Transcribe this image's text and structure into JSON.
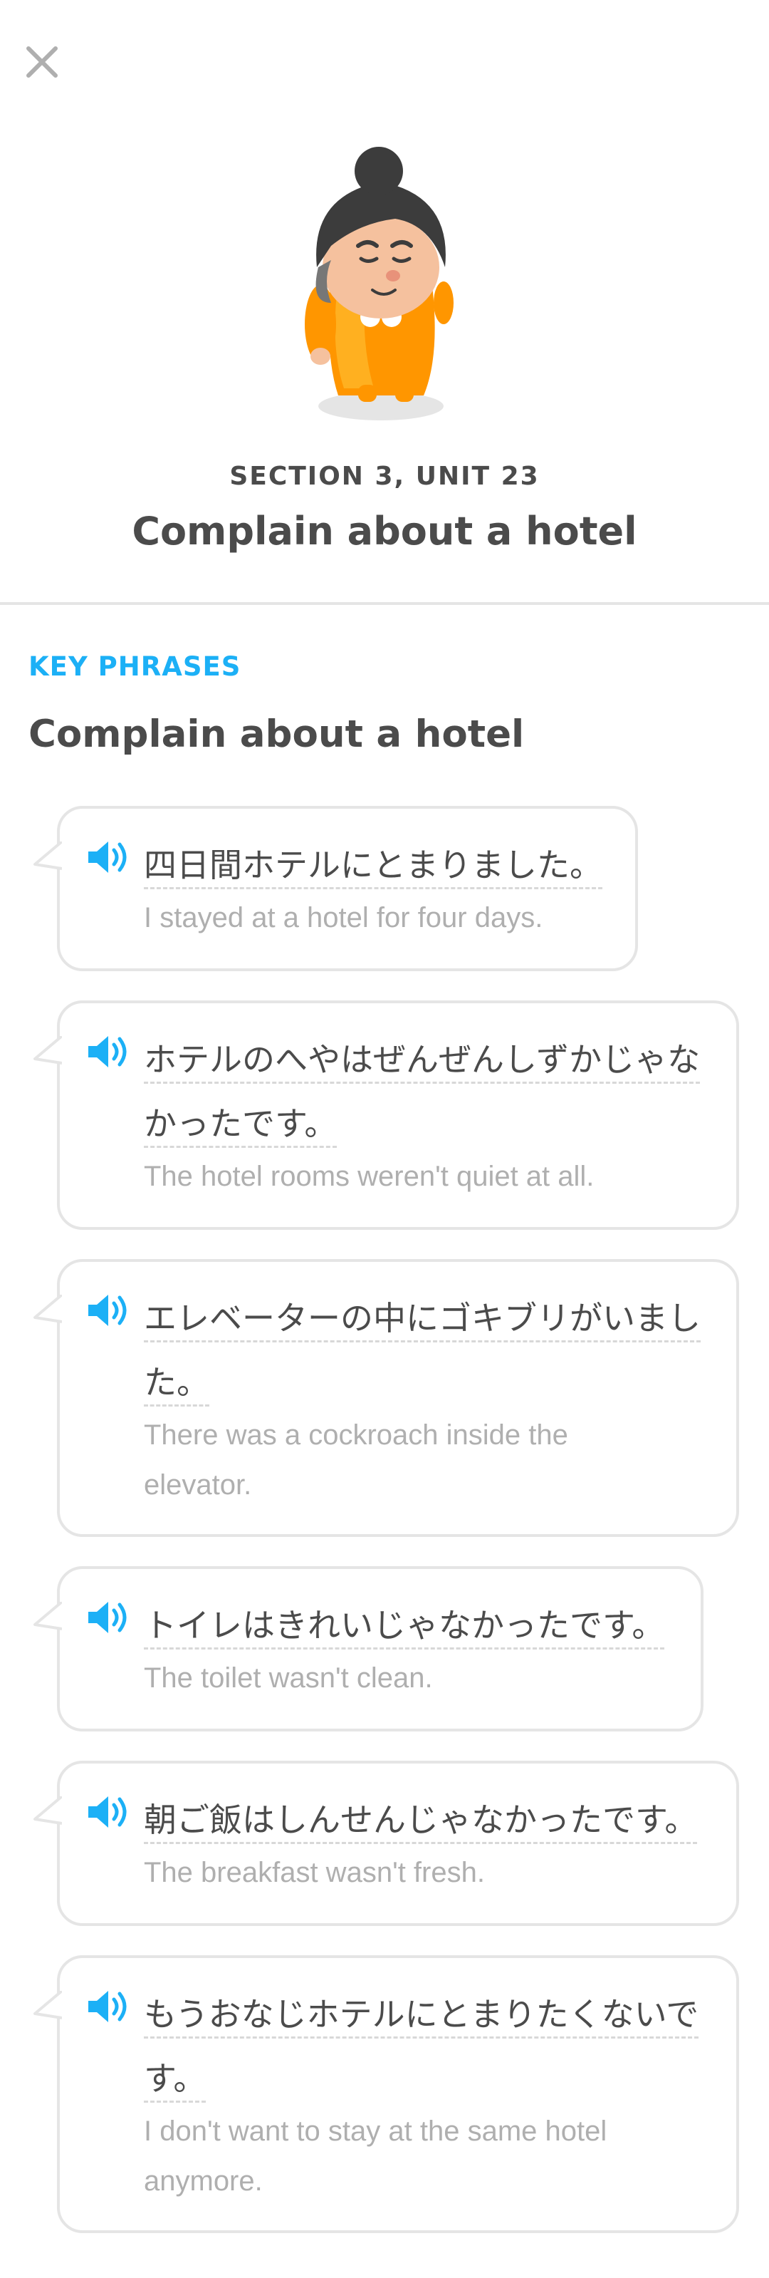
{
  "header": {
    "unit_label": "SECTION 3, UNIT 23",
    "unit_title": "Complain about a hotel"
  },
  "icons": {
    "close": "close-icon",
    "speaker": "speaker-icon",
    "mascot": "lily-character-illustration"
  },
  "colors": {
    "accent": "#1cb0f6",
    "character_dress": "#ff9600",
    "hair": "#3c3c3c",
    "border": "#e5e5e5",
    "muted_text": "#afafaf"
  },
  "key_phrases": {
    "label": "KEY PHRASES",
    "title": "Complain about a hotel",
    "phrases": [
      {
        "jp": "四日間ホテルにとまりました。",
        "en": "I stayed at a hotel for four days."
      },
      {
        "jp_lines": [
          "ホテルのへやはぜんぜんしずかじゃな",
          "かったです。"
        ],
        "en": "The hotel rooms weren't quiet at all."
      },
      {
        "jp_lines": [
          "エレベーターの中にゴキブリがいまし",
          "た。"
        ],
        "en_lines": [
          "There was a cockroach inside the",
          "elevator."
        ]
      },
      {
        "jp": "トイレはきれいじゃなかったです。",
        "en": "The toilet wasn't clean."
      },
      {
        "jp": "朝ご飯はしんせんじゃなかったです。",
        "en": "The breakfast wasn't fresh."
      },
      {
        "jp_lines": [
          "もうおなじホテルにとまりたくないで",
          "す。"
        ],
        "en_lines": [
          "I don't want to stay at the same hotel",
          "anymore."
        ]
      }
    ]
  }
}
